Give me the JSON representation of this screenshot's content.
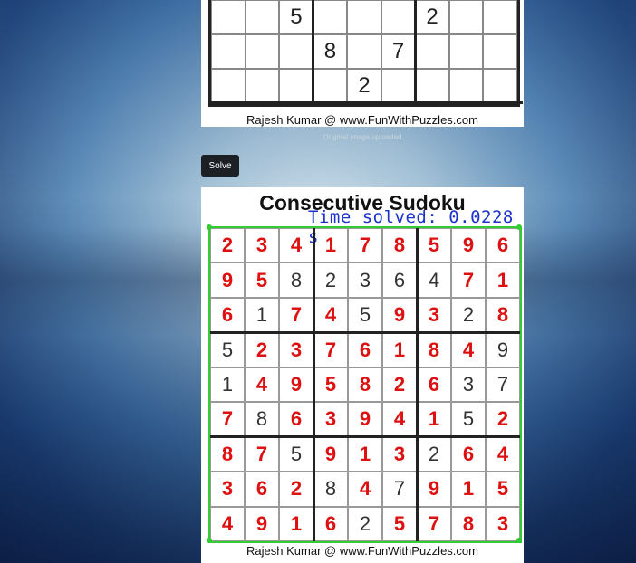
{
  "original": {
    "rows": [
      [
        "",
        "",
        "5",
        "",
        "",
        "",
        "2",
        "",
        ""
      ],
      [
        "",
        "",
        "",
        "8",
        "",
        "7",
        "",
        "",
        ""
      ],
      [
        "",
        "",
        "",
        "",
        "2",
        "",
        "",
        "",
        ""
      ]
    ],
    "credit": "Rajesh Kumar @ www.FunWithPuzzles.com",
    "caption": "Original image uploaded"
  },
  "solve_button": "Solve",
  "solved": {
    "title": "Consecutive Sudoku",
    "time_label": "Time solved: 0.0228 s",
    "credit": "Rajesh Kumar @ www.FunWithPuzzles.com",
    "grid": [
      [
        "2",
        "3",
        "4",
        "1",
        "7",
        "8",
        "5",
        "9",
        "6"
      ],
      [
        "9",
        "5",
        "8",
        "2",
        "3",
        "6",
        "4",
        "7",
        "1"
      ],
      [
        "6",
        "1",
        "7",
        "4",
        "5",
        "9",
        "3",
        "2",
        "8"
      ],
      [
        "5",
        "2",
        "3",
        "7",
        "6",
        "1",
        "8",
        "4",
        "9"
      ],
      [
        "1",
        "4",
        "9",
        "5",
        "8",
        "2",
        "6",
        "3",
        "7"
      ],
      [
        "7",
        "8",
        "6",
        "3",
        "9",
        "4",
        "1",
        "5",
        "2"
      ],
      [
        "8",
        "7",
        "5",
        "9",
        "1",
        "3",
        "2",
        "6",
        "4"
      ],
      [
        "3",
        "6",
        "2",
        "8",
        "4",
        "7",
        "9",
        "1",
        "5"
      ],
      [
        "4",
        "9",
        "1",
        "6",
        "2",
        "5",
        "7",
        "8",
        "3"
      ]
    ],
    "given_mask": [
      [
        0,
        0,
        0,
        0,
        0,
        0,
        0,
        0,
        0
      ],
      [
        0,
        0,
        1,
        1,
        1,
        1,
        1,
        0,
        0
      ],
      [
        0,
        1,
        0,
        0,
        1,
        0,
        0,
        1,
        0
      ],
      [
        1,
        0,
        0,
        0,
        0,
        0,
        0,
        0,
        1
      ],
      [
        1,
        0,
        0,
        0,
        0,
        0,
        0,
        1,
        1
      ],
      [
        0,
        1,
        0,
        0,
        0,
        0,
        0,
        1,
        0
      ],
      [
        0,
        0,
        1,
        0,
        0,
        0,
        1,
        0,
        0
      ],
      [
        0,
        0,
        0,
        1,
        0,
        1,
        0,
        0,
        0
      ],
      [
        0,
        0,
        0,
        0,
        1,
        0,
        0,
        0,
        0
      ]
    ],
    "colors": {
      "solved_digit": "#dd1111",
      "given_digit": "#333333",
      "border": "#33cc33",
      "time": "#1a33cc"
    }
  }
}
